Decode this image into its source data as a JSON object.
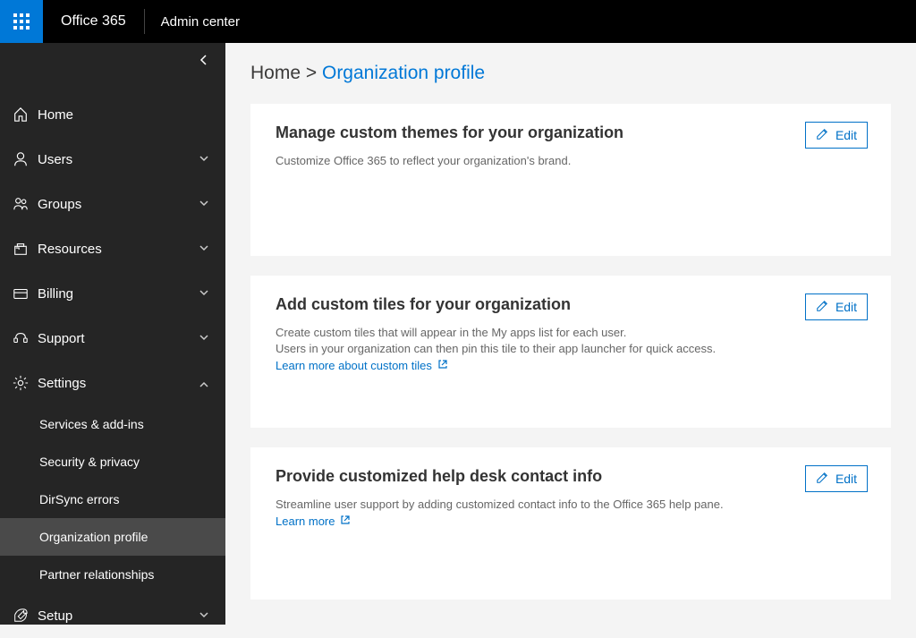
{
  "header": {
    "brand": "Office 365",
    "subtitle": "Admin center"
  },
  "breadcrumb": {
    "root": "Home",
    "sep": ">",
    "current": "Organization profile"
  },
  "sidebar": {
    "items": [
      {
        "label": "Home"
      },
      {
        "label": "Users"
      },
      {
        "label": "Groups"
      },
      {
        "label": "Resources"
      },
      {
        "label": "Billing"
      },
      {
        "label": "Support"
      },
      {
        "label": "Settings"
      },
      {
        "label": "Setup"
      }
    ],
    "settings_sub": [
      {
        "label": "Services & add-ins"
      },
      {
        "label": "Security & privacy"
      },
      {
        "label": "DirSync errors"
      },
      {
        "label": "Organization profile"
      },
      {
        "label": "Partner relationships"
      }
    ]
  },
  "cards": {
    "themes": {
      "title": "Manage custom themes for your organization",
      "desc": "Customize Office 365 to reflect your organization's brand.",
      "edit": "Edit"
    },
    "tiles": {
      "title": "Add custom tiles for your organization",
      "desc1": "Create custom tiles that will appear in the My apps list for each user.",
      "desc2": "Users in your organization can then pin this tile to their app launcher for quick access.",
      "link": "Learn more about custom tiles",
      "edit": "Edit"
    },
    "helpdesk": {
      "title": "Provide customized help desk contact info",
      "desc": "Streamline user support by adding customized contact info to the Office 365 help pane.",
      "link": "Learn more",
      "edit": "Edit"
    }
  }
}
